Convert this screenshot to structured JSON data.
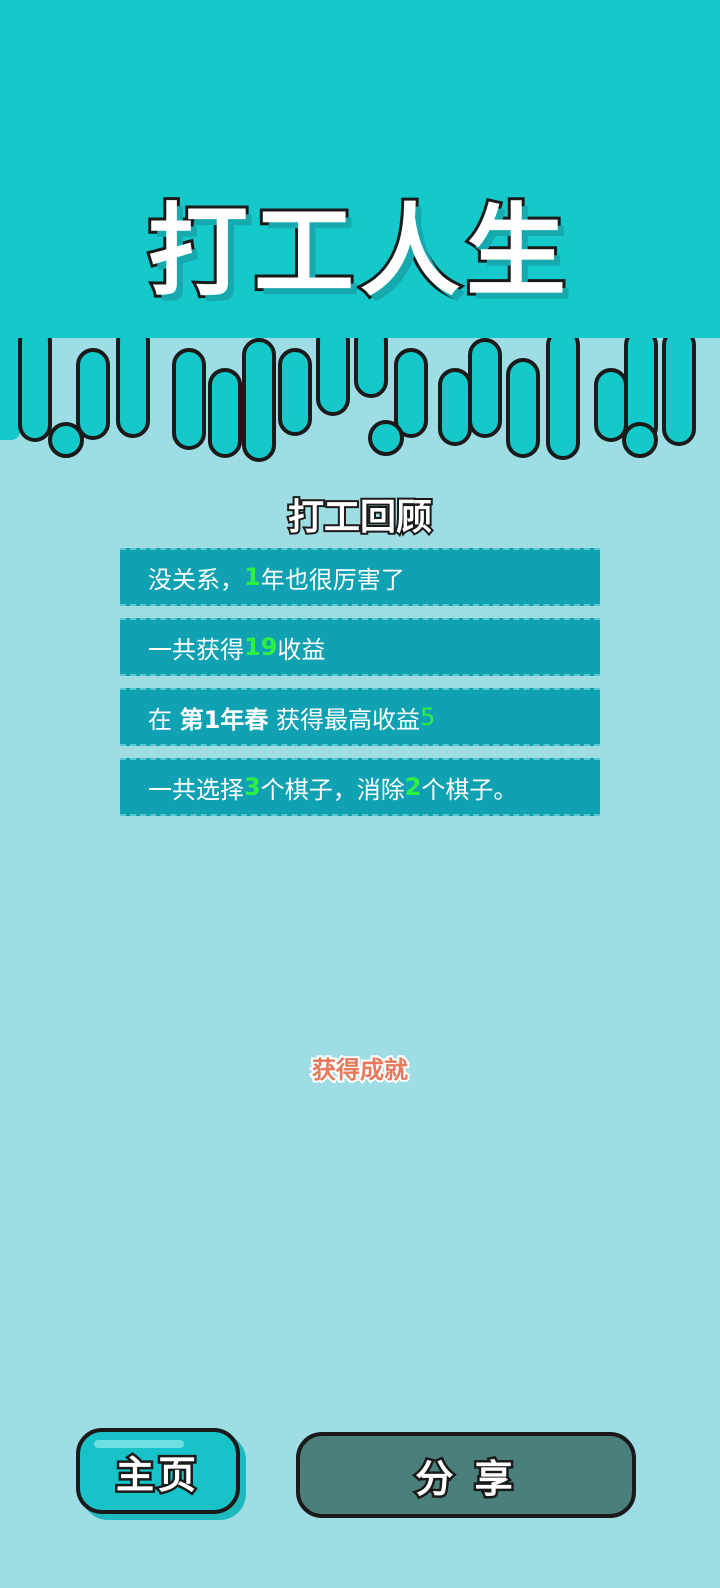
{
  "title": "打工人生",
  "review": {
    "heading": "打工回顾",
    "rows": [
      {
        "a": "没关系，",
        "num": "1",
        "b": "年也很厉害了"
      },
      {
        "a": "一共获得",
        "num": "19",
        "b": "收益"
      },
      {
        "a": "在 ",
        "bold": "第1年春",
        "b": " 获得最高收益",
        "num": "5"
      },
      {
        "a": "一共选择",
        "num1": "3",
        "b": "个棋子，消除",
        "num2": "2",
        "c": "个棋子。"
      }
    ]
  },
  "achievement_label": "获得成就",
  "buttons": {
    "home": "主页",
    "share": "分 享"
  },
  "colors": {
    "top": "#15c8c9",
    "background": "#9fdde4",
    "row": "#10a2b3",
    "highlight": "#2df043",
    "achievement": "#e6795b",
    "share_button": "#4b7f7b"
  }
}
